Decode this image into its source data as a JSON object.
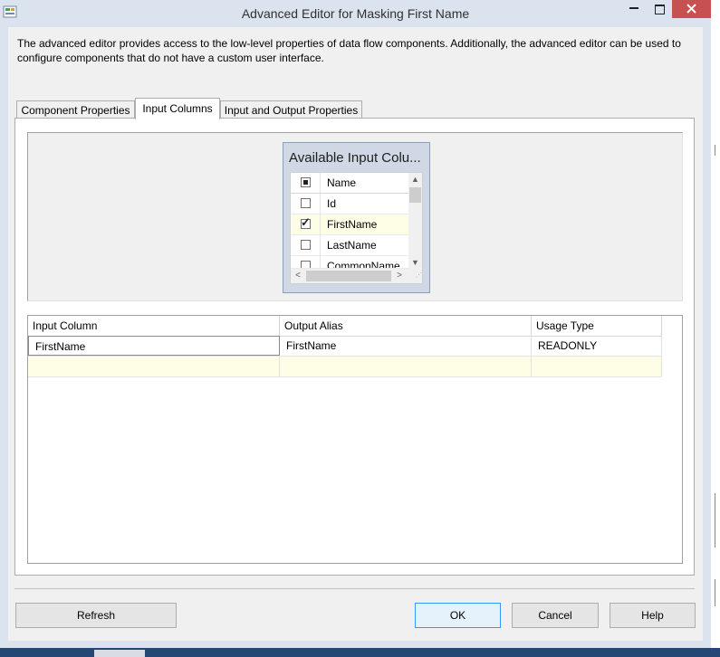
{
  "window": {
    "title": "Advanced Editor for Masking First Name",
    "app_icon": "ssis-component-icon",
    "minimize_glyph": "—",
    "maximize_glyph": "□",
    "close_glyph": "✕",
    "description": "The advanced editor provides access to the low-level properties of data flow components. Additionally, the advanced editor can be used to configure components that do not have a custom user interface."
  },
  "tabs": [
    {
      "label": "Component Properties",
      "active": false
    },
    {
      "label": "Input Columns",
      "active": true
    },
    {
      "label": "Input and Output Properties",
      "active": false
    }
  ],
  "available_columns": {
    "title": "Available Input Colu...",
    "header": "Name",
    "items": [
      {
        "label": "Id",
        "checked": false
      },
      {
        "label": "FirstName",
        "checked": true
      },
      {
        "label": "LastName",
        "checked": false
      },
      {
        "label": "CommonName",
        "checked": false
      }
    ],
    "up_arrow": "▲",
    "down_arrow": "▼",
    "left_arrow": "<",
    "right_arrow": ">"
  },
  "grid": {
    "headers": [
      "Input Column",
      "Output Alias",
      "Usage Type"
    ],
    "rows": [
      [
        "FirstName",
        "FirstName",
        "READONLY"
      ]
    ]
  },
  "buttons": {
    "refresh": "Refresh",
    "ok": "OK",
    "cancel": "Cancel",
    "help": "Help"
  },
  "colors": {
    "chrome": "#dbe4ee",
    "close_button": "#c75050",
    "selected_row": "#fefde6",
    "default_button_border": "#3399ff"
  }
}
